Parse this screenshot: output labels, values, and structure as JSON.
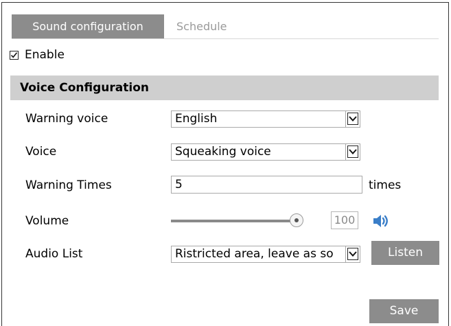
{
  "tabs": [
    {
      "label": "Sound configuration",
      "active": true
    },
    {
      "label": "Schedule",
      "active": false
    }
  ],
  "enable": {
    "label": "Enable",
    "checked": true
  },
  "section": {
    "title": "Voice Configuration"
  },
  "warning_voice": {
    "label": "Warning voice",
    "value": "English"
  },
  "voice": {
    "label": "Voice",
    "value": "Squeaking voice"
  },
  "warning_times": {
    "label": "Warning Times",
    "value": "5",
    "unit": "times"
  },
  "volume": {
    "label": "Volume",
    "value": "100",
    "level_percent": 100
  },
  "audio_list": {
    "label": "Audio List",
    "value": "Ristricted area, leave as so"
  },
  "buttons": {
    "listen": "Listen",
    "save": "Save"
  },
  "colors": {
    "tab_active_bg": "#8c8c8c",
    "section_bg": "#cfcfcf",
    "button_bg": "#8c8c8c",
    "speaker": "#3a7ec8"
  },
  "icons": {
    "checkbox": "check-icon",
    "select_arrow": "chevron-down-icon",
    "volume": "speaker-icon"
  }
}
